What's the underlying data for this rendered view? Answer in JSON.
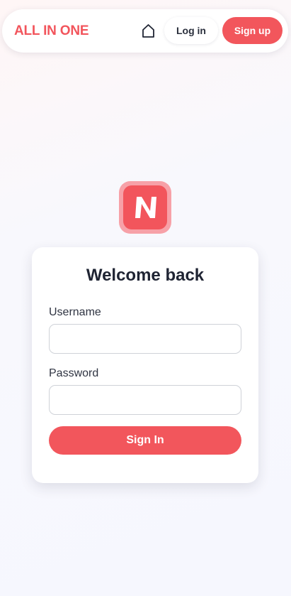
{
  "header": {
    "brand": "ALL IN ONE",
    "home_icon": "home-icon",
    "login_label": "Log in",
    "signup_label": "Sign up"
  },
  "logo": {
    "icon": "app-logo",
    "color": "#f2555c"
  },
  "login_form": {
    "title": "Welcome back",
    "username_label": "Username",
    "username_value": "",
    "password_label": "Password",
    "password_value": "",
    "submit_label": "Sign In"
  },
  "colors": {
    "accent": "#f2555c",
    "text": "#1f2433"
  }
}
